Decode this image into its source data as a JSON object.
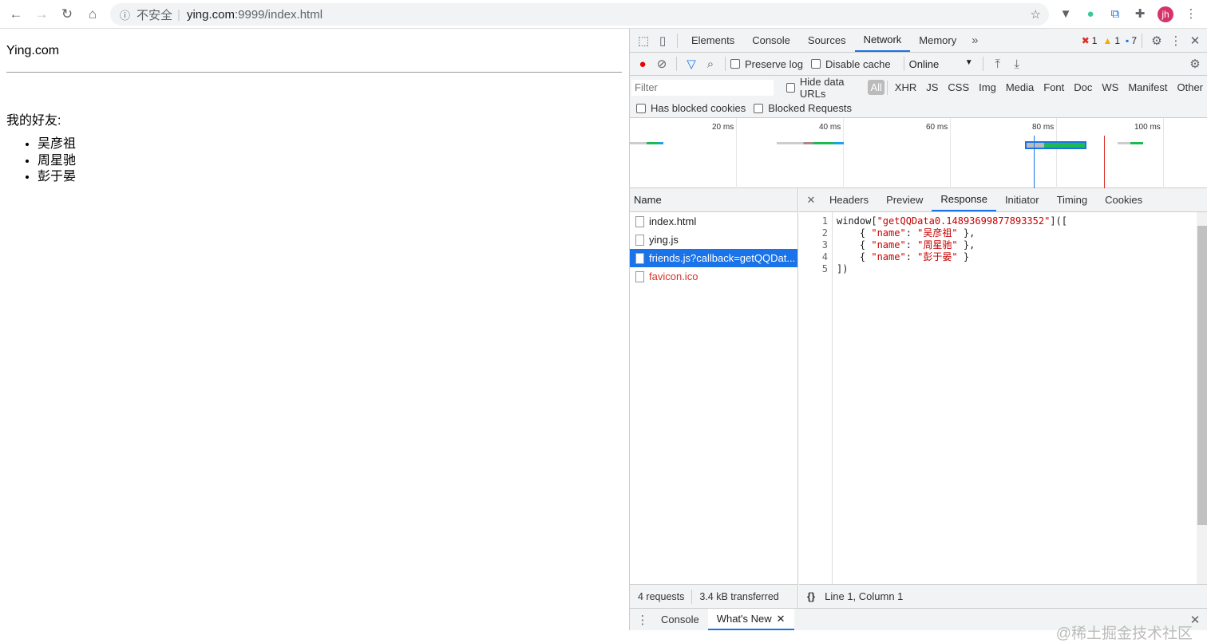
{
  "browser": {
    "security_label": "不安全",
    "url_host": "ying.com",
    "url_rest": ":9999/index.html",
    "avatar": "jh"
  },
  "page": {
    "title": "Ying.com",
    "label": "我的好友:",
    "friends": [
      "吴彦祖",
      "周星驰",
      "彭于晏"
    ]
  },
  "devtools": {
    "tabs": [
      "Elements",
      "Console",
      "Sources",
      "Network",
      "Memory"
    ],
    "active_tab": "Network",
    "errors": "1",
    "warnings": "1",
    "messages": "7",
    "preserve_log": "Preserve log",
    "disable_cache": "Disable cache",
    "throttle": "Online",
    "filter_placeholder": "Filter",
    "hide_data_urls": "Hide data URLs",
    "filter_types": [
      "All",
      "XHR",
      "JS",
      "CSS",
      "Img",
      "Media",
      "Font",
      "Doc",
      "WS",
      "Manifest",
      "Other"
    ],
    "has_blocked_cookies": "Has blocked cookies",
    "blocked_requests": "Blocked Requests",
    "timeline_ticks": [
      "20 ms",
      "40 ms",
      "60 ms",
      "80 ms",
      "100 ms"
    ],
    "name_header": "Name",
    "requests": [
      {
        "name": "index.html"
      },
      {
        "name": "ying.js"
      },
      {
        "name": "friends.js?callback=getQQDat..."
      },
      {
        "name": "favicon.ico"
      }
    ],
    "detail_tabs": [
      "Headers",
      "Preview",
      "Response",
      "Initiator",
      "Timing",
      "Cookies"
    ],
    "response_lines": [
      [
        {
          "t": "window["
        },
        {
          "t": "\"getQQData0.14893699877893352\"",
          "s": 1
        },
        {
          "t": "](["
        }
      ],
      [
        {
          "t": "    { "
        },
        {
          "t": "\"name\"",
          "s": 1
        },
        {
          "t": ": "
        },
        {
          "t": "\"吴彦祖\"",
          "s": 1
        },
        {
          "t": " },"
        }
      ],
      [
        {
          "t": "    { "
        },
        {
          "t": "\"name\"",
          "s": 1
        },
        {
          "t": ": "
        },
        {
          "t": "\"周星驰\"",
          "s": 1
        },
        {
          "t": " },"
        }
      ],
      [
        {
          "t": "    { "
        },
        {
          "t": "\"name\"",
          "s": 1
        },
        {
          "t": ": "
        },
        {
          "t": "\"彭于晏\"",
          "s": 1
        },
        {
          "t": " }"
        }
      ],
      [
        {
          "t": "])"
        }
      ]
    ],
    "summary_requests": "4 requests",
    "summary_transferred": "3.4 kB transferred",
    "cursor_position": "Line 1, Column 1",
    "drawer_tabs": [
      "Console",
      "What's New"
    ],
    "watermark": "@稀土掘金技术社区"
  }
}
